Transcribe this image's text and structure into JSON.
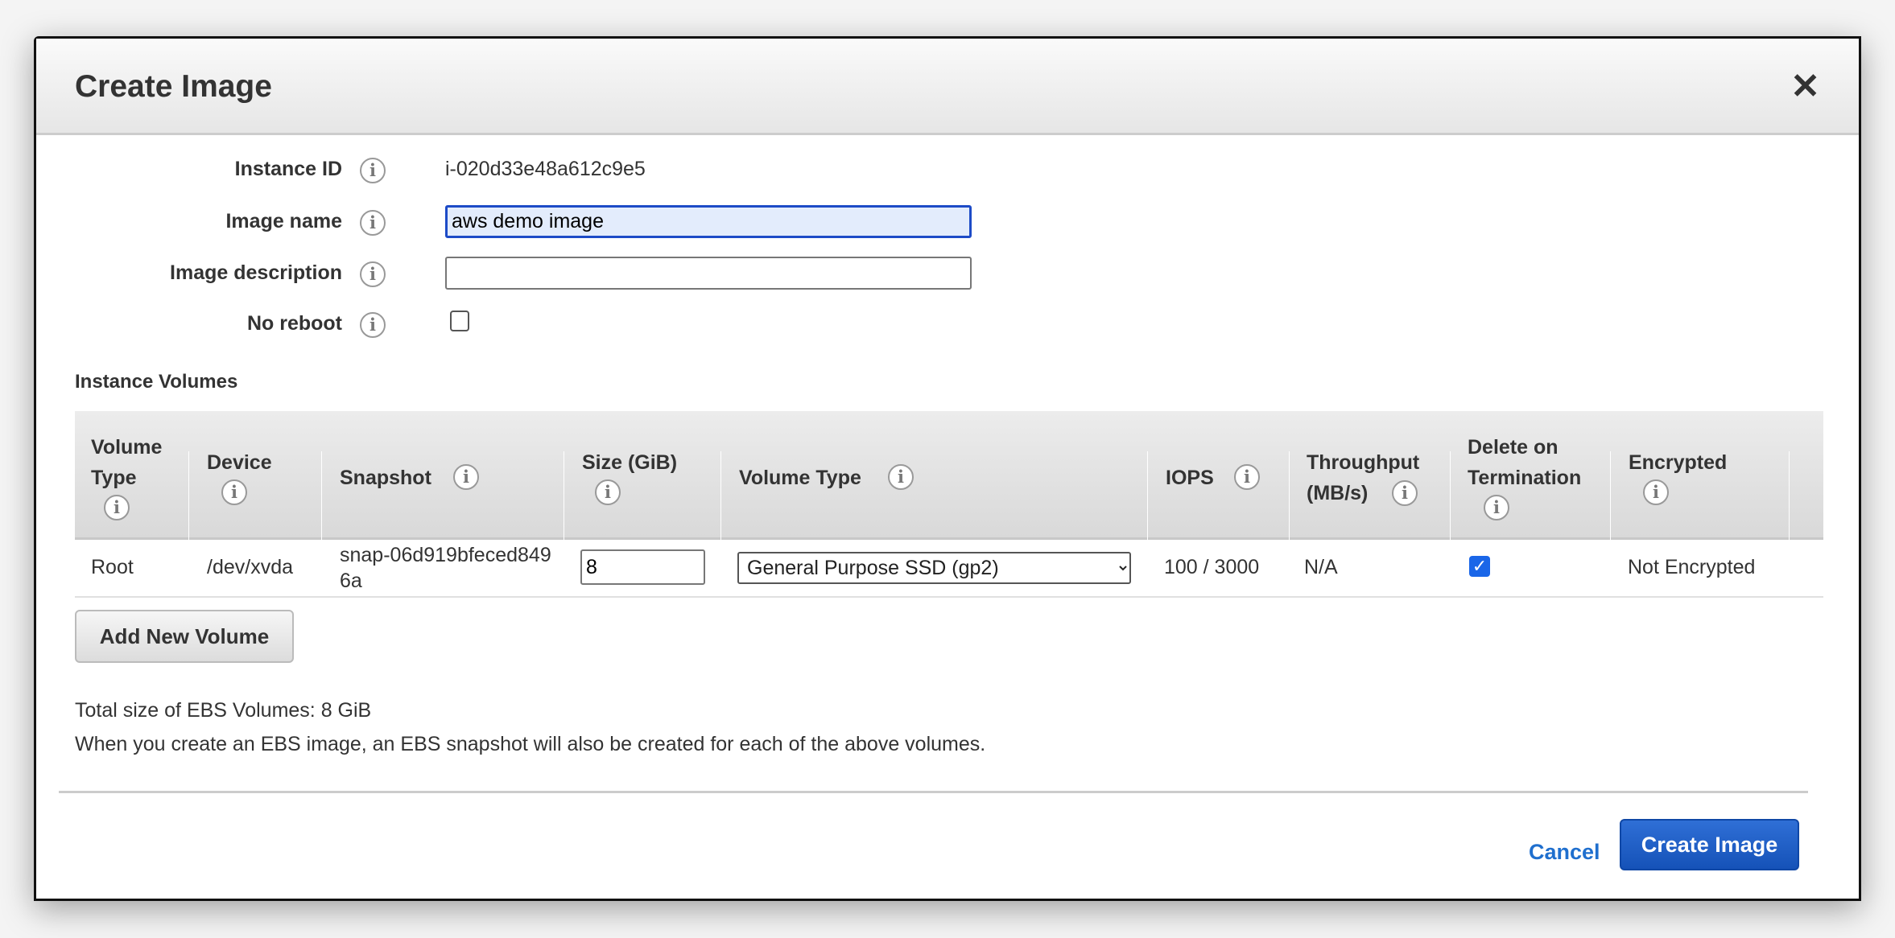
{
  "dialog": {
    "title": "Create Image",
    "close_icon": "close-icon"
  },
  "form": {
    "instance_id_label": "Instance ID",
    "instance_id_value": "i-020d33e48a612c9e5",
    "image_name_label": "Image name",
    "image_name_value": "aws demo image",
    "image_description_label": "Image description",
    "image_description_value": "",
    "no_reboot_label": "No reboot",
    "no_reboot_checked": false
  },
  "volumes": {
    "section_title": "Instance Volumes",
    "headers": [
      "Volume Type",
      "Device",
      "Snapshot",
      "Size (GiB)",
      "Volume Type",
      "IOPS",
      "Throughput (MB/s)",
      "Delete on Termination",
      "Encrypted"
    ],
    "rows": [
      {
        "volume_type": "Root",
        "device": "/dev/xvda",
        "snapshot": "snap-06d919bfeced8496a",
        "size": "8",
        "type_select": "General Purpose SSD (gp2)",
        "iops": "100 / 3000",
        "throughput": "N/A",
        "delete_on_termination": true,
        "encrypted": "Not Encrypted"
      }
    ],
    "add_button": "Add New Volume"
  },
  "notes": {
    "total": "Total size of EBS Volumes: 8 GiB",
    "info": "When you create an EBS image, an EBS snapshot will also be created for each of the above volumes."
  },
  "footer": {
    "cancel": "Cancel",
    "create": "Create Image"
  },
  "colors": {
    "primary": "#1a5bc4",
    "link": "#1f6fce",
    "focus": "#1d4bc7"
  }
}
